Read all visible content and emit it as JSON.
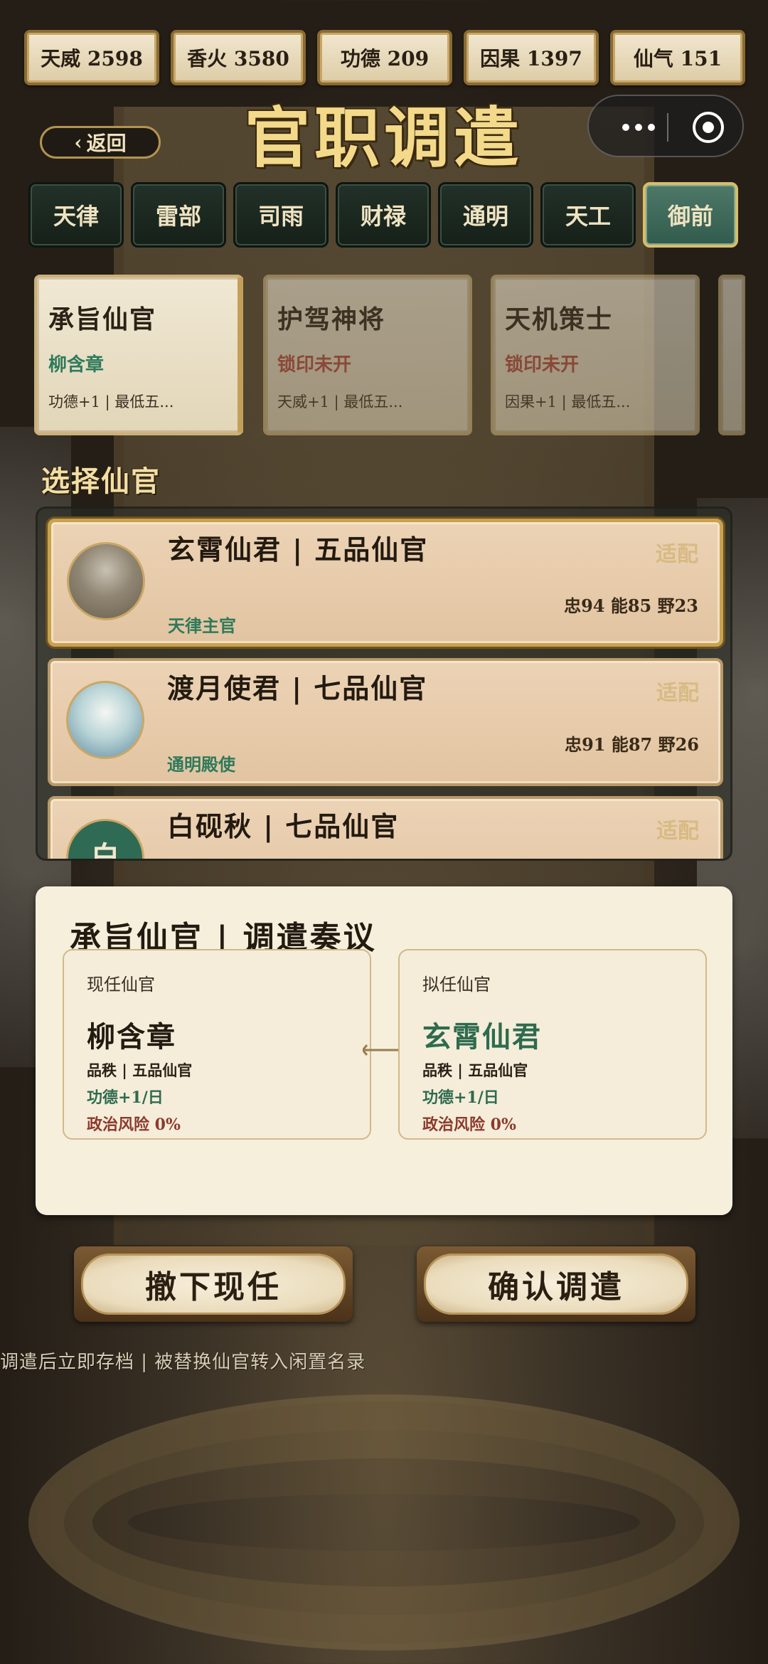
{
  "resources": [
    {
      "label": "天威 2598"
    },
    {
      "label": "香火 3580"
    },
    {
      "label": "功德 209"
    },
    {
      "label": "因果 1397"
    },
    {
      "label": "仙气 151"
    }
  ],
  "header": {
    "title": "官职调遣",
    "back_label": "返回",
    "back_chevron": "‹"
  },
  "departments": [
    {
      "label": "天律"
    },
    {
      "label": "雷部"
    },
    {
      "label": "司雨"
    },
    {
      "label": "财禄"
    },
    {
      "label": "通明"
    },
    {
      "label": "天工"
    },
    {
      "label": "御前",
      "active": true
    }
  ],
  "positions": [
    {
      "name": "承旨仙官",
      "holder": "柳含章",
      "meta": "功德+1 | 最低五...",
      "locked": false
    },
    {
      "name": "护驾神将",
      "holder": "锁印未开",
      "meta": "天威+1 | 最低五...",
      "locked": true
    },
    {
      "name": "天机策士",
      "holder": "锁印未开",
      "meta": "因果+1 | 最低五...",
      "locked": true
    }
  ],
  "select_section": {
    "title": "选择仙官"
  },
  "candidates": [
    {
      "name": "玄霄仙君 | 五品仙官",
      "fit": "适配",
      "stats": "忠94 能85 野23",
      "role": "天律主官",
      "selected": true
    },
    {
      "name": "渡月使君 | 七品仙官",
      "fit": "适配",
      "stats": "忠91 能87 野26",
      "role": "通明殿使",
      "selected": false
    },
    {
      "name": "白砚秋 | 七品仙官",
      "fit": "适配",
      "avatar_char": "白",
      "selected": false
    }
  ],
  "proposal": {
    "title": "承旨仙官 | 调遣奏议",
    "current": {
      "label": "现任仙官",
      "name": "柳含章",
      "rank": "品秩 | 五品仙官",
      "merit": "功德+1/日",
      "risk": "政治风险 0%"
    },
    "proposed": {
      "label": "拟任仙官",
      "name": "玄霄仙君",
      "rank": "品秩 | 五品仙官",
      "merit": "功德+1/日",
      "risk": "政治风险 0%"
    }
  },
  "actions": {
    "remove_label": "撤下现任",
    "confirm_label": "确认调遣"
  },
  "footnote": "调遣后立即存档 | 被替换仙官转入闲置名录",
  "colors": {
    "accent_gold": "#d9bd6a",
    "active_tab": "#4e7868",
    "locked_red": "#b84b3e",
    "jade_green": "#2e7a5b"
  }
}
